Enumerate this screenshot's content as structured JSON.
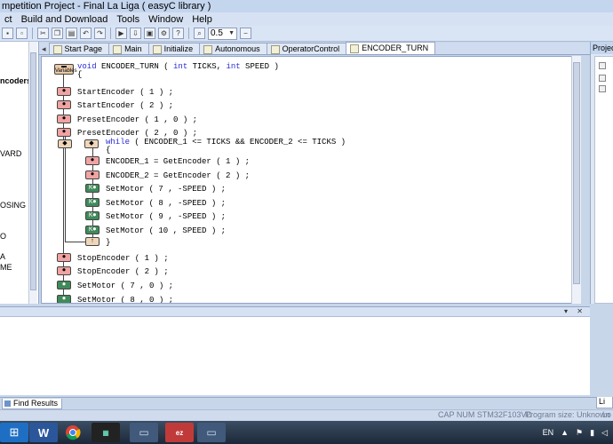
{
  "window": {
    "title": "mpetition Project - Final La Liga  ( easyC library )"
  },
  "menu": [
    "ct",
    "Build and Download",
    "Tools",
    "Window",
    "Help"
  ],
  "toolbar": {
    "zoom_value": "0.5"
  },
  "left_panel": {
    "items": [
      "ncoders",
      "VARD",
      "OSING",
      "O",
      "A",
      "ME"
    ]
  },
  "tabs": [
    "Start Page",
    "Main",
    "Initialize",
    "Autonomous",
    "OperatorControl",
    "ENCODER_TURN"
  ],
  "editor": {
    "function_signature": {
      "kw1": "void",
      "name": " ENCODER_TURN ( ",
      "kw2": "int",
      "p1": " TICKS, ",
      "kw3": "int",
      "p2": " SPEED )"
    },
    "open_brace": "{",
    "lines": [
      "StartEncoder ( 1 ) ;",
      "StartEncoder ( 2 ) ;",
      "PresetEncoder ( 1 , 0 ) ;",
      "PresetEncoder ( 2 , 0 ) ;"
    ],
    "while_kw": "while",
    "while_cond": " ( ENCODER_1 <= TICKS && ENCODER_2 <= TICKS  )",
    "inner_open": "{",
    "inner_lines": [
      "ENCODER_1 = GetEncoder ( 1 ) ;",
      "ENCODER_2 = GetEncoder ( 2 ) ;",
      "SetMotor ( 7 , -SPEED ) ;",
      "SetMotor ( 8 , -SPEED ) ;",
      "SetMotor ( 9 , -SPEED ) ;",
      "SetMotor ( 10 , SPEED ) ;"
    ],
    "inner_close": "}",
    "after_lines": [
      "StopEncoder ( 1 ) ;",
      "StopEncoder ( 2 ) ;",
      "SetMotor ( 7 , 0 ) ;",
      "SetMotor ( 8 , 0 ) ;"
    ],
    "var_block_label": "Variables"
  },
  "right_panel": {
    "title": "Project"
  },
  "bottom": {
    "tab_label": "Find Results",
    "right_tab": "Li"
  },
  "status": {
    "capnum": "CAP  NUM  STM32F103VD",
    "program_size": "Program size: Unknown",
    "last": "Lo"
  },
  "tray": {
    "lang": "EN"
  },
  "colors": {
    "keyword": "#2b2bd6",
    "accent": "#c4d5ee"
  }
}
